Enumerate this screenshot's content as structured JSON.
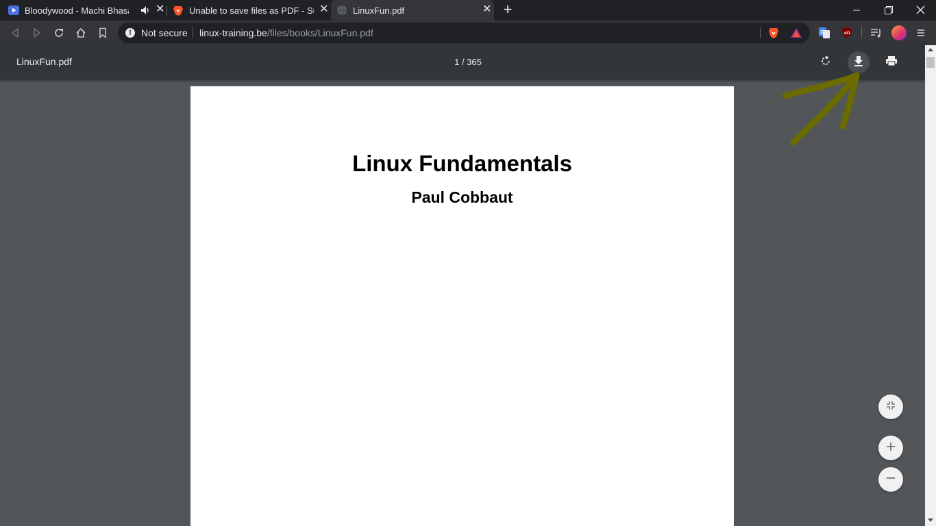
{
  "tabs": [
    {
      "title": "Bloodywood - Machi Bhasad (",
      "favicon": "youtube-play-icon",
      "audio": "speaker-icon",
      "close": "✕"
    },
    {
      "title": "Unable to save files as PDF - Suppo",
      "favicon": "brave-lion-icon",
      "close": "✕"
    },
    {
      "title": "LinuxFun.pdf",
      "favicon": "globe-icon",
      "close": "✕",
      "active": true
    }
  ],
  "new_tab": "+",
  "omnibox": {
    "security_label": "Not secure",
    "url_host": "linux-training.be",
    "url_path": "/files/books/LinuxFun.pdf"
  },
  "pdf_toolbar": {
    "filename": "LinuxFun.pdf",
    "page_indicator": "1 / 365"
  },
  "document": {
    "title": "Linux Fundamentals",
    "author": "Paul Cobbaut"
  },
  "colors": {
    "annotation_arrow": "#6b6b00",
    "brave_orange": "#fb542b"
  }
}
